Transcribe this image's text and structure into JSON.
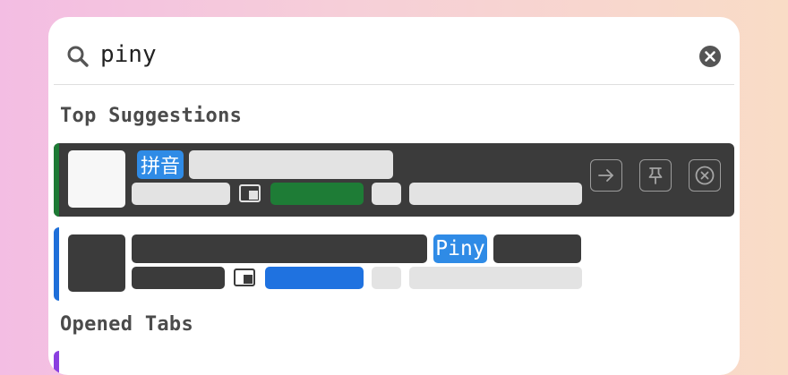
{
  "search": {
    "query": "piny",
    "icon": "search-icon",
    "clear_icon": "clear-icon"
  },
  "sections": {
    "top_suggestions": "Top Suggestions",
    "opened_tabs": "Opened Tabs"
  },
  "results": [
    {
      "selected": true,
      "match_badge": "拼音",
      "badge_color": "#2f8be6",
      "accent_color": "#1d7a35",
      "tag_color": "#1e7c36",
      "actions": [
        "open-arrow-icon",
        "pin-icon",
        "close-circle-icon"
      ]
    },
    {
      "selected": false,
      "match_badge": "Piny",
      "badge_color": "#2f8be6",
      "accent_color": "#1e6fd9",
      "tag_color": "#1f72e0"
    }
  ],
  "colors": {
    "selected_row_bg": "#3b3b3b",
    "placeholder_light": "#e3e3e3",
    "placeholder_dark": "#3b3b3b",
    "opened_tab_accent": "#8a3fe0"
  }
}
